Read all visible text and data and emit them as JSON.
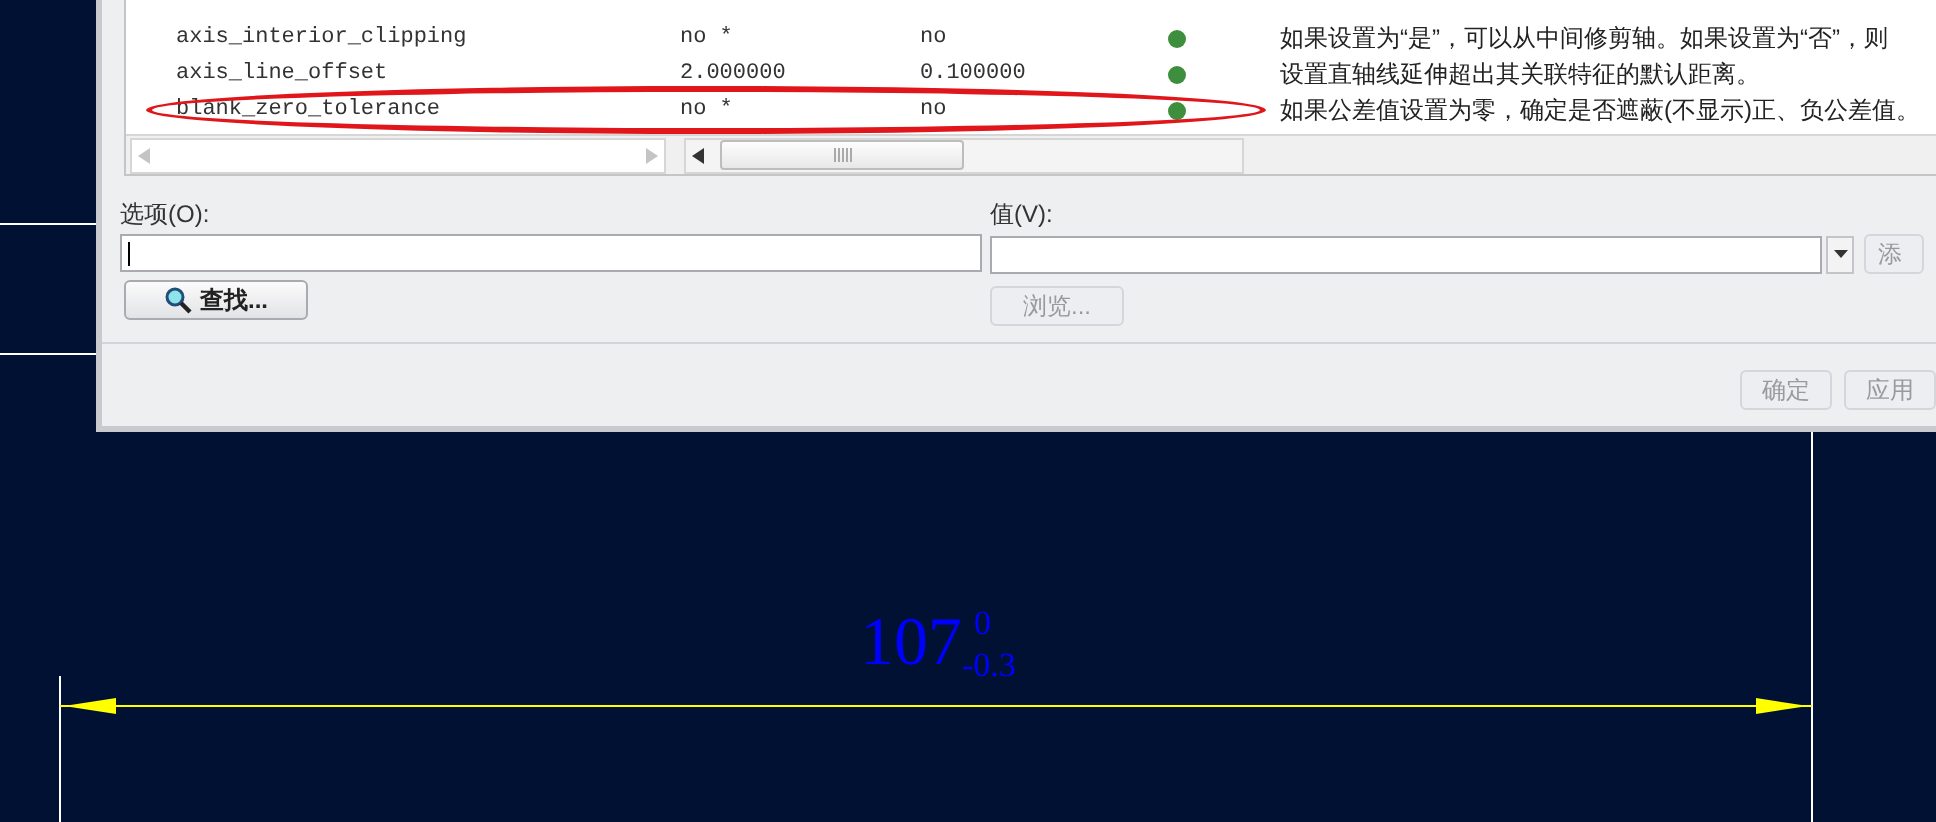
{
  "options_table": {
    "rows": [
      {
        "name": "axis_interior_clipping",
        "value": "no *",
        "default": "no",
        "description": "如果设置为“是”，可以从中间修剪轴。如果设置为“否”，则",
        "highlighted": false
      },
      {
        "name": "axis_line_offset",
        "value": "2.000000",
        "default": "0.100000",
        "description": "设置直轴线延伸超出其关联特征的默认距离。",
        "highlighted": false
      },
      {
        "name": "blank_zero_tolerance",
        "value": "no *",
        "default": "no",
        "description": "如果公差值设置为零，确定是否遮蔽(不显示)正、负公差值。",
        "highlighted": true
      }
    ]
  },
  "option_field": {
    "label": "选项(O):"
  },
  "value_field": {
    "label": "值(V):"
  },
  "buttons": [
    {
      "kind": "find",
      "label": "查找...",
      "disabled": false
    },
    {
      "kind": "browse",
      "label": "浏览...",
      "disabled": true
    },
    {
      "kind": "add",
      "label": "添",
      "disabled": true
    },
    {
      "kind": "ok",
      "label": "确定",
      "disabled": true
    },
    {
      "kind": "apply",
      "label": "应用",
      "disabled": true
    }
  ],
  "drawing": {
    "dimension": "107",
    "upper_tolerance": "0",
    "lower_tolerance": "-0.3"
  }
}
